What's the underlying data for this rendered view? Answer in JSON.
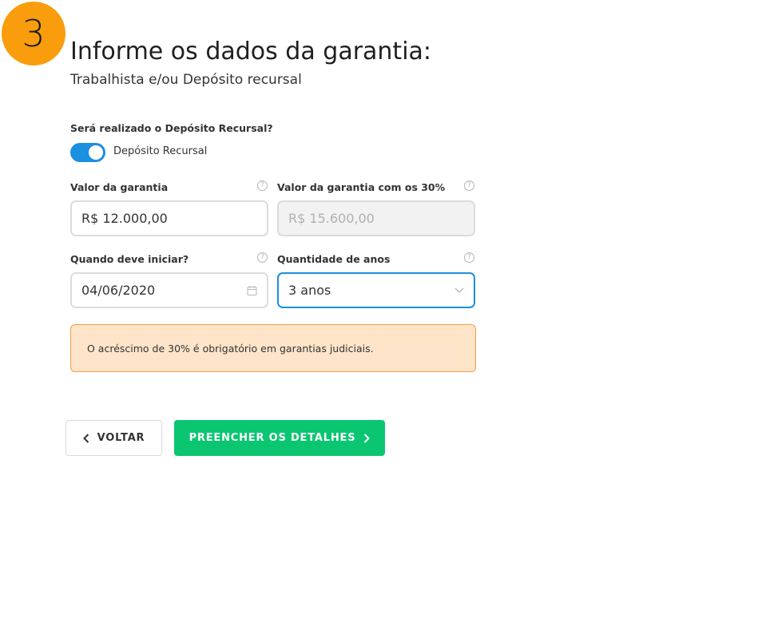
{
  "step": {
    "number": "3"
  },
  "header": {
    "title": "Informe os dados da garantia:",
    "subtitle": "Trabalhista e/ou Depósito recursal"
  },
  "deposit_question": {
    "label": "Será realizado o Depósito Recursal?",
    "toggle_label": "Depósito Recursal",
    "toggle_on": true
  },
  "fields": {
    "guarantee_value": {
      "label": "Valor da garantia",
      "value": "R$ 12.000,00"
    },
    "guarantee_value_30": {
      "label": "Valor da garantia com os 30%",
      "value": "R$ 15.600,00"
    },
    "start_date": {
      "label": "Quando deve iniciar?",
      "value": "04/06/2020"
    },
    "years": {
      "label": "Quantidade de anos",
      "value": "3 anos"
    }
  },
  "alert": {
    "text": "O acréscimo de 30% é obrigatório em garantias judiciais."
  },
  "actions": {
    "back_label": "VOLTAR",
    "next_label": "PREENCHER OS DETALHES"
  },
  "icons": {
    "help": "help-circle-icon",
    "calendar": "calendar-icon",
    "chevron_down": "chevron-down-icon",
    "chevron_left": "chevron-left-icon",
    "chevron_right": "chevron-right-icon"
  },
  "colors": {
    "step_badge": "#f99d0c",
    "toggle": "#1b8fe0",
    "primary_button": "#0bc671",
    "alert_bg": "#fee4c9",
    "alert_border": "#f0a04a",
    "focus_border": "#1b8fe0"
  }
}
